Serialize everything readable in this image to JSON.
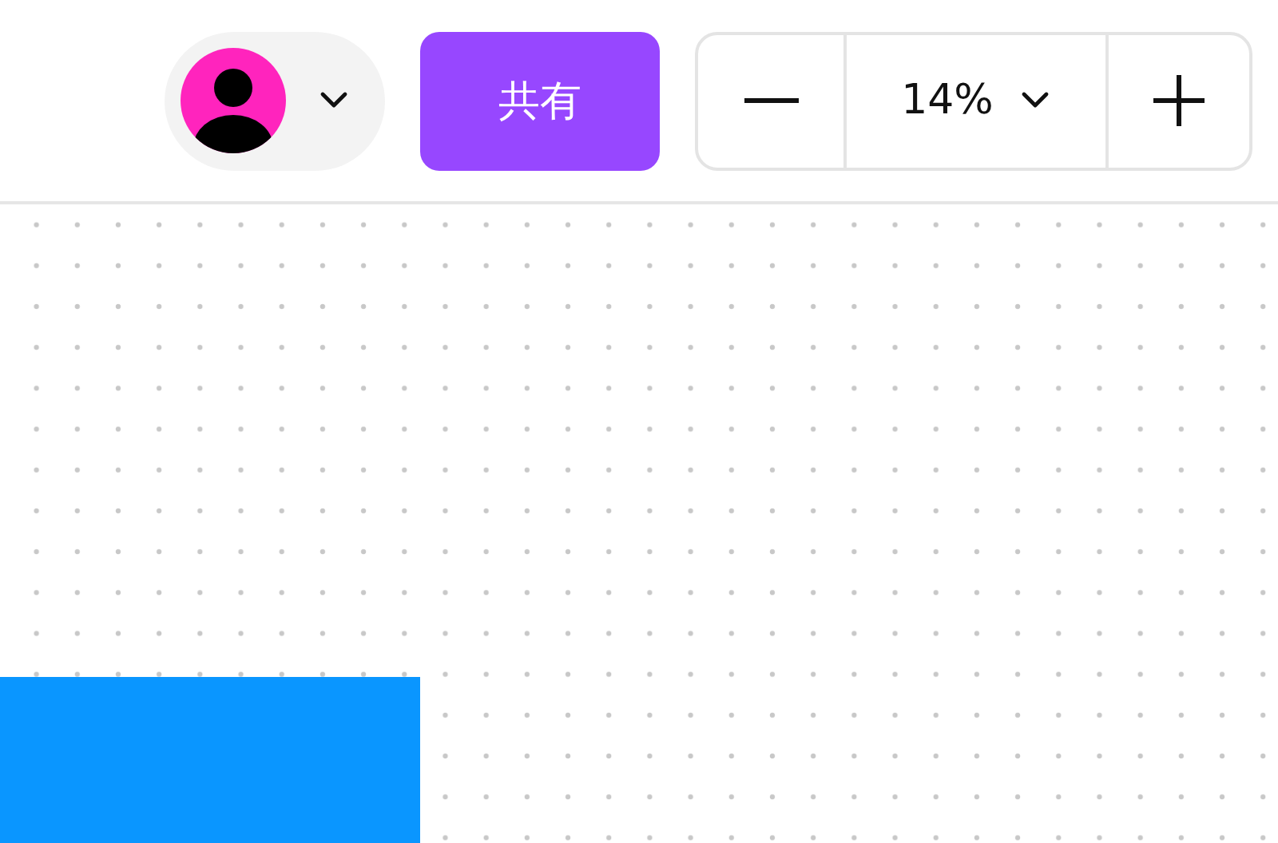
{
  "toolbar": {
    "share_button": {
      "label": "共有"
    },
    "zoom": {
      "value": "14%"
    }
  },
  "canvas": {
    "shapes": [
      {
        "kind": "rectangle",
        "color": "#0a96ff"
      }
    ]
  }
}
